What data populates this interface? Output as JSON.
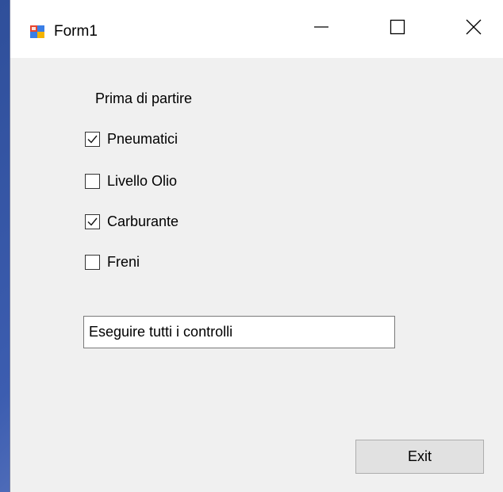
{
  "window": {
    "title": "Form1",
    "controls": {
      "minimize_icon": "minimize-icon",
      "maximize_icon": "maximize-icon",
      "close_icon": "close-icon"
    }
  },
  "form": {
    "group_label": "Prima di partire",
    "checkboxes": [
      {
        "label": "Pneumatici",
        "checked": true
      },
      {
        "label": "Livello Olio",
        "checked": false
      },
      {
        "label": "Carburante",
        "checked": true
      },
      {
        "label": "Freni",
        "checked": false
      }
    ],
    "status_text": "Eseguire tutti i controlli",
    "exit_label": "Exit"
  },
  "colors": {
    "window_background": "#f0f0f0",
    "titlebar_background": "#ffffff",
    "button_background": "#e1e1e1"
  }
}
